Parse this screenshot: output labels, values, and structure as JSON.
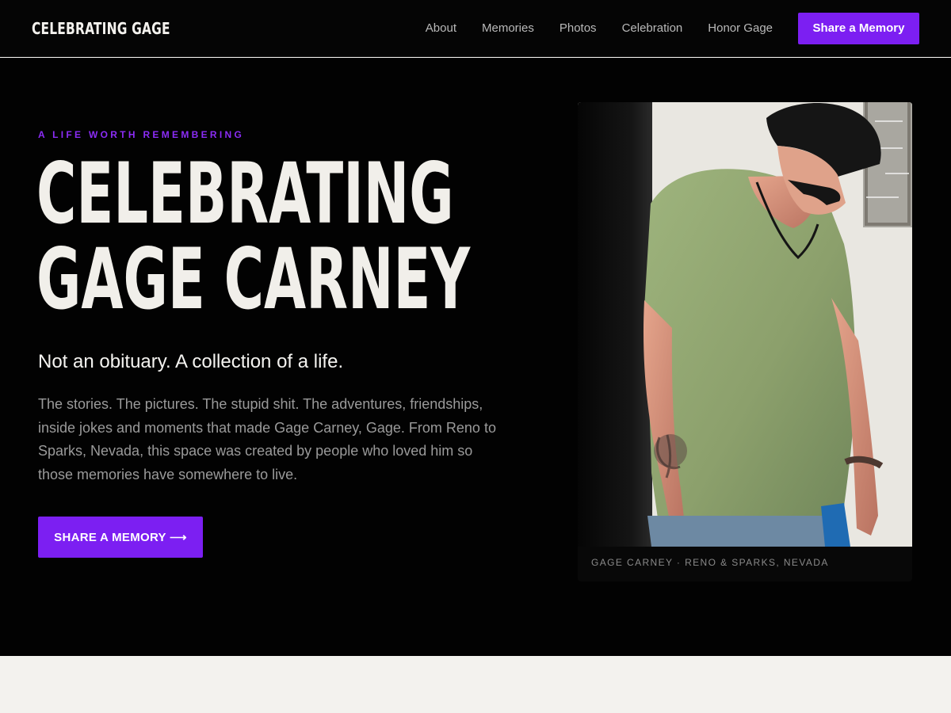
{
  "nav": {
    "brand": "CELEBRATING GAGE",
    "links": [
      "About",
      "Memories",
      "Photos",
      "Celebration",
      "Honor Gage"
    ],
    "cta": "Share a Memory"
  },
  "hero": {
    "eyebrow": "A LIFE WORTH REMEMBERING",
    "title_line1": "CELEBRATING",
    "title_line2": "GAGE CARNEY",
    "subtitle": "Not an obituary. A collection of a life.",
    "body": "The stories. The pictures. The stupid shit. The adventures, friendships, inside jokes and moments that made Gage Carney, Gage. From Reno to Sparks, Nevada, this space was created by people who loved him so those memories have somewhere to live.",
    "cta": "SHARE A MEMORY ⟶",
    "photo_caption": "GAGE CARNEY · RENO & SPARKS, NEVADA"
  },
  "colors": {
    "accent": "#7c1ff2",
    "hero_background": "#020202",
    "headline": "#f1efea",
    "lower_background": "#f3f2ee"
  }
}
